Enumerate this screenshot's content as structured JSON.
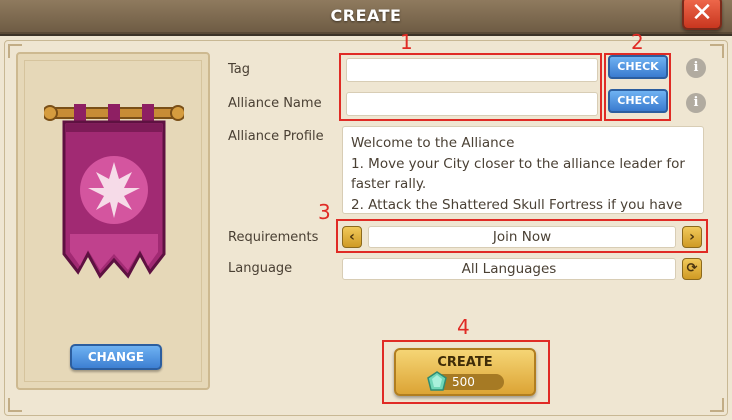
{
  "window": {
    "title": "CREATE",
    "close_symbol": "✕"
  },
  "banner": {
    "change_label": "CHANGE"
  },
  "form": {
    "tag": {
      "label": "Tag",
      "value": "",
      "check_label": "CHECK"
    },
    "alliance_name": {
      "label": "Alliance Name",
      "value": "",
      "check_label": "CHECK"
    },
    "info_symbol": "i",
    "profile": {
      "label": "Alliance Profile",
      "lines": [
        "Welcome to the Alliance",
        "1. Move your City closer to the alliance leader for",
        "faster rally.",
        "2. Attack the Shattered Skull Fortress if you have"
      ]
    },
    "requirements": {
      "label": "Requirements",
      "value": "Join Now",
      "prev_symbol": "‹",
      "next_symbol": "›"
    },
    "language": {
      "label": "Language",
      "value": "All Languages",
      "refresh_symbol": "⟳"
    }
  },
  "create": {
    "label": "CREATE",
    "cost": "500"
  },
  "annotations": [
    "1",
    "2",
    "3",
    "4"
  ],
  "colors": {
    "accent_blue": "#3d7fd2",
    "gold": "#dca435",
    "banner_magenta": "#a12a73",
    "highlight_red": "#e02b25"
  }
}
